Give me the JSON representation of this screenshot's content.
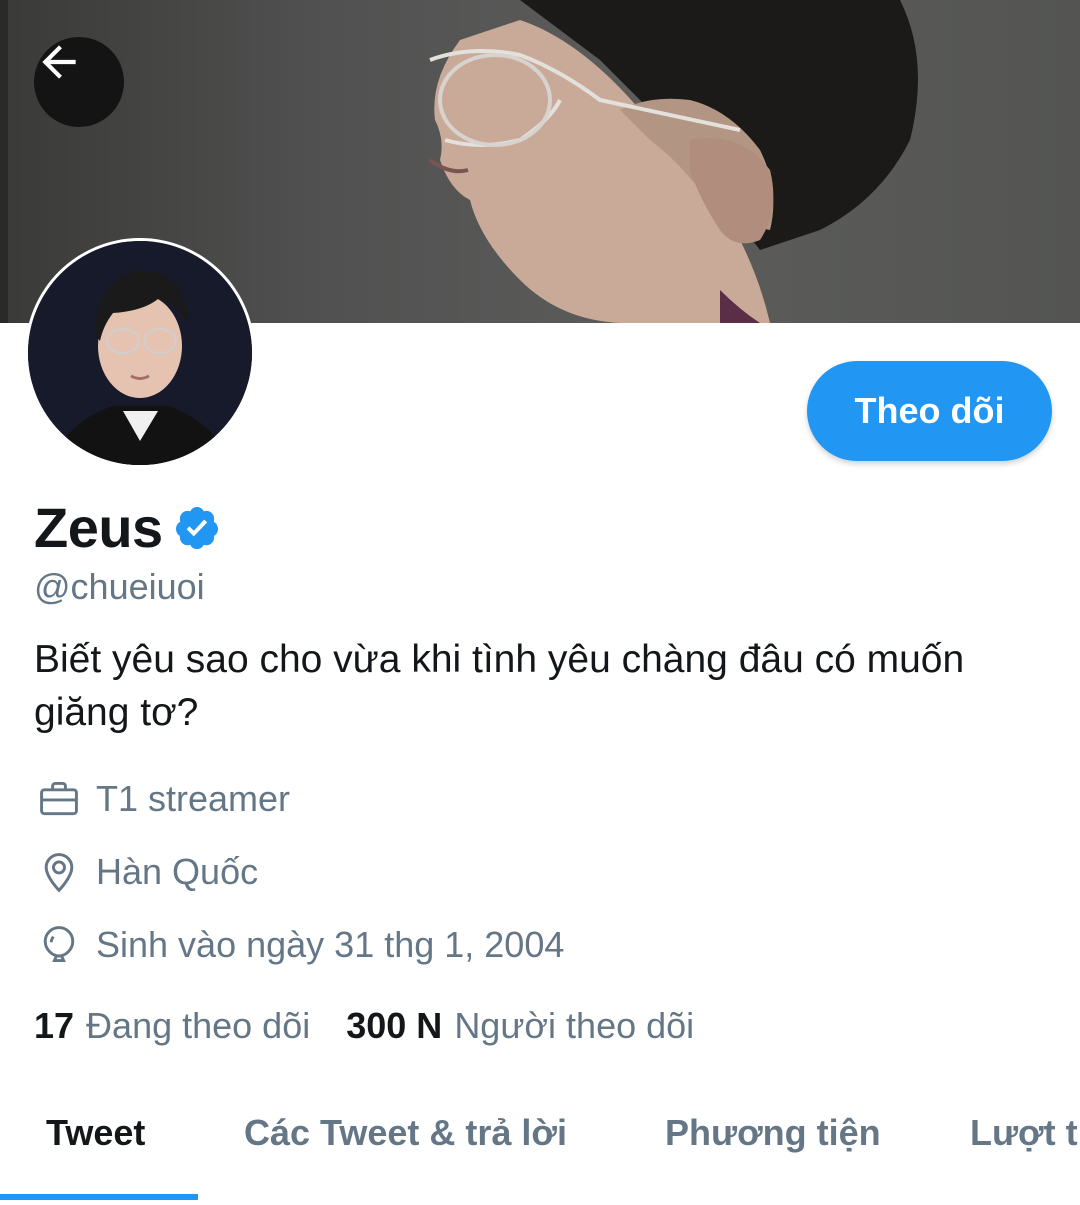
{
  "profile": {
    "display_name": "Zeus",
    "verified": true,
    "handle": "@chueiuoi",
    "bio": "Biết yêu sao cho vừa khi tình yêu chàng đâu có muốn giăng tơ?",
    "work": "T1 streamer",
    "location": "Hàn Quốc",
    "birthday": "Sinh vào ngày 31 thg 1, 2004"
  },
  "actions": {
    "follow_label": "Theo dõi"
  },
  "stats": {
    "following_count": "17",
    "following_label": "Đang theo dõi",
    "followers_count": "300 N",
    "followers_label": "Người theo dõi"
  },
  "tabs": [
    {
      "label": "Tweet",
      "active": true
    },
    {
      "label": "Các Tweet & trả lời",
      "active": false
    },
    {
      "label": "Phương tiện",
      "active": false
    },
    {
      "label": "Lượt thích",
      "active": false
    }
  ],
  "icons": {
    "back": "arrow-left-icon",
    "verified": "verified-badge-icon",
    "work": "briefcase-icon",
    "location": "location-pin-icon",
    "birthday": "balloon-icon"
  },
  "colors": {
    "accent": "#2196f3",
    "secondary_text": "#657786",
    "primary_text": "#14171a"
  }
}
